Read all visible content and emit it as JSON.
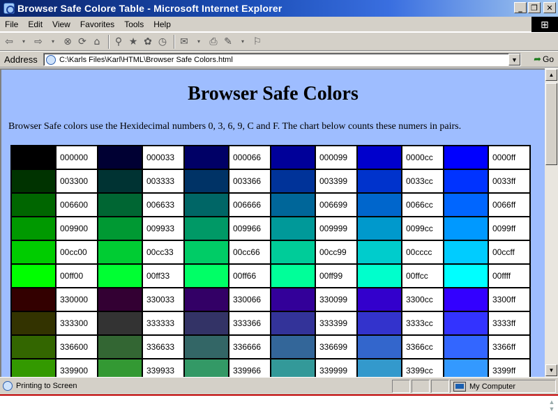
{
  "window": {
    "title": "Browser Safe Colore Table - Microsoft Internet Explorer",
    "minimize_glyph": "_",
    "restore_glyph": "❐",
    "close_glyph": "✕"
  },
  "menu": [
    {
      "key": "file",
      "label": "File"
    },
    {
      "key": "edit",
      "label": "Edit"
    },
    {
      "key": "view",
      "label": "View"
    },
    {
      "key": "favorites",
      "label": "Favorites"
    },
    {
      "key": "tools",
      "label": "Tools"
    },
    {
      "key": "help",
      "label": "Help"
    }
  ],
  "toolbar": {
    "icons": [
      "back-icon",
      "forward-icon",
      "stop-icon",
      "refresh-icon",
      "home-icon",
      "search-icon",
      "favorites-icon",
      "history-icon",
      "mail-icon",
      "print-icon",
      "edit-icon",
      "discuss-icon"
    ]
  },
  "address": {
    "label": "Address",
    "value": "C:\\Karls Files\\Karl\\HTML\\Browser Safe Colors.html",
    "go_label": "Go"
  },
  "page": {
    "title": "Browser Safe Colors",
    "intro": "Browser Safe colors use the Hexidecimal numbers 0, 3, 6, 9, C and F. The chart below counts these numers in pairs.",
    "rows": [
      [
        "000000",
        "000033",
        "000066",
        "000099",
        "0000cc",
        "0000ff"
      ],
      [
        "003300",
        "003333",
        "003366",
        "003399",
        "0033cc",
        "0033ff"
      ],
      [
        "006600",
        "006633",
        "006666",
        "006699",
        "0066cc",
        "0066ff"
      ],
      [
        "009900",
        "009933",
        "009966",
        "009999",
        "0099cc",
        "0099ff"
      ],
      [
        "00cc00",
        "00cc33",
        "00cc66",
        "00cc99",
        "00cccc",
        "00ccff"
      ],
      [
        "00ff00",
        "00ff33",
        "00ff66",
        "00ff99",
        "00ffcc",
        "00ffff"
      ],
      [
        "330000",
        "330033",
        "330066",
        "330099",
        "3300cc",
        "3300ff"
      ],
      [
        "333300",
        "333333",
        "333366",
        "333399",
        "3333cc",
        "3333ff"
      ],
      [
        "336600",
        "336633",
        "336666",
        "336699",
        "3366cc",
        "3366ff"
      ],
      [
        "339900",
        "339933",
        "339966",
        "339999",
        "3399cc",
        "3399ff"
      ]
    ]
  },
  "status": {
    "text": "Printing to Screen",
    "zone": "My Computer"
  },
  "colors": {
    "page_background": "#9ebdff",
    "chrome": "#d4d0c8",
    "title_bar": "#0a246a"
  }
}
